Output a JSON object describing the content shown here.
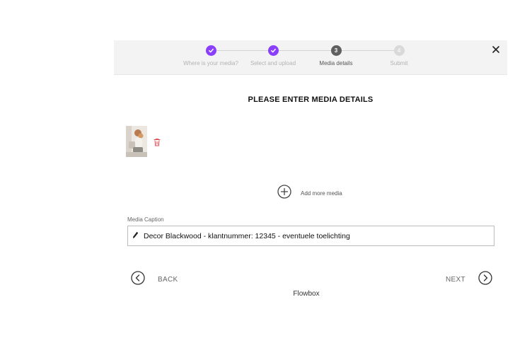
{
  "stepper": {
    "steps": [
      {
        "label": "Where is your media?",
        "state": "done",
        "number": ""
      },
      {
        "label": "Select and upload",
        "state": "done",
        "number": ""
      },
      {
        "label": "Media details",
        "state": "current",
        "number": "3"
      },
      {
        "label": "Submit",
        "state": "todo",
        "number": "4"
      }
    ]
  },
  "close_icon": "close-icon",
  "title": "PLEASE ENTER MEDIA DETAILS",
  "media": {
    "thumbnail_icon": "photo-thumbnail",
    "delete_icon": "trash-icon"
  },
  "add_more": {
    "label": "Add more media",
    "icon": "plus-circle-icon"
  },
  "caption": {
    "label": "Media Caption",
    "value": "Decor Blackwood - klantnummer: 12345 - eventuele toelichting",
    "icon": "pencil-icon"
  },
  "nav": {
    "back_label": "BACK",
    "next_label": "NEXT"
  },
  "brand": "Flowbox",
  "colors": {
    "accent": "#8a3ffc",
    "current_step": "#5f5f5f",
    "delete": "#e0464f",
    "header_bg": "#f3f3f3"
  }
}
